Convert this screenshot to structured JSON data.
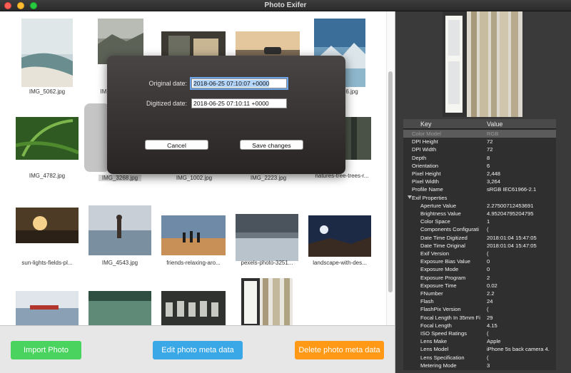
{
  "window": {
    "title": "Photo Exifer"
  },
  "grid": {
    "captions": [
      "IMG_5062.jpg",
      "IMG_4782.jpg",
      "IMG_3268.jpg",
      "IMG_1002.jpg",
      "IMG_2223.jpg",
      "natures-tree-trees-r...",
      "sun-lights-fields-pl...",
      "IMG_4543.jpg",
      "friends-relaxing-aro...",
      "pexels-photo-3251...",
      "landscape-with-des...",
      "IM",
      "6.jpg"
    ]
  },
  "dialog": {
    "original_label": "Original date:",
    "original_value": "2018-06-25 07:10:07 +0000",
    "digitized_label": "Digitized date:",
    "digitized_value": "2018-06-25 07:10:11 +0000",
    "cancel": "Cancel",
    "save": "Save changes"
  },
  "buttons": {
    "import": "Import Photo",
    "edit": "Edit photo meta data",
    "delete": "Delete photo meta data"
  },
  "table": {
    "key_header": "Key",
    "value_header": "Value",
    "rows": [
      {
        "k": "Color Model",
        "v": "RGB"
      },
      {
        "k": "DPI Height",
        "v": "72"
      },
      {
        "k": "DPI Width",
        "v": "72"
      },
      {
        "k": "Depth",
        "v": "8"
      },
      {
        "k": "Orientation",
        "v": "6"
      },
      {
        "k": "Pixel Height",
        "v": "2,448"
      },
      {
        "k": "Pixel Width",
        "v": "3,264"
      },
      {
        "k": "Profile Name",
        "v": "sRGB IEC61966-2.1"
      },
      {
        "k": "Exif Properties",
        "v": ""
      },
      {
        "k": "Aperture Value",
        "v": "2.27500712453691"
      },
      {
        "k": "Brightness Value",
        "v": "4.95204795204795"
      },
      {
        "k": "Color Space",
        "v": "1"
      },
      {
        "k": "Components Configurati",
        "v": "("
      },
      {
        "k": "Date Time Digitized",
        "v": "2018:01:04 15:47:05"
      },
      {
        "k": "Date Time Original",
        "v": "2018:01:04 15:47:05"
      },
      {
        "k": "Exif Version",
        "v": "("
      },
      {
        "k": "Exposure Bias Value",
        "v": "0"
      },
      {
        "k": "Exposure Mode",
        "v": "0"
      },
      {
        "k": "Exposure Program",
        "v": "2"
      },
      {
        "k": "Exposure Time",
        "v": "0.02"
      },
      {
        "k": "FNumber",
        "v": "2.2"
      },
      {
        "k": "Flash",
        "v": "24"
      },
      {
        "k": "FlashPix Version",
        "v": "("
      },
      {
        "k": "Focal Length In 35mm Fi",
        "v": "29"
      },
      {
        "k": "Focal Length",
        "v": "4.15"
      },
      {
        "k": "ISO Speed Ratings",
        "v": "("
      },
      {
        "k": "Lens Make",
        "v": "Apple"
      },
      {
        "k": "Lens Model",
        "v": "iPhone 5s back camera 4."
      },
      {
        "k": "Lens Specification",
        "v": "("
      },
      {
        "k": "Metering Mode",
        "v": "3"
      }
    ]
  }
}
